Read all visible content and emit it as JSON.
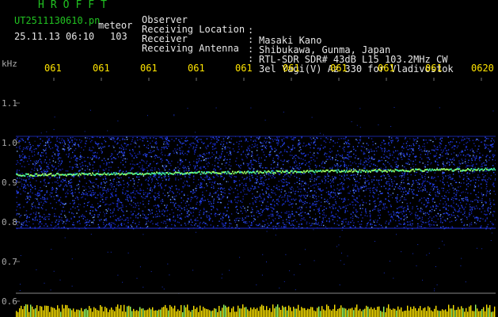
{
  "header": {
    "brand": "HROFFT",
    "filename": "UT2511130610.pn",
    "mode": "meteor",
    "datetime": "25.11.13 06:10",
    "count": "103",
    "info": [
      {
        "key": "Observer",
        "value": "Masaki Kano"
      },
      {
        "key": "Receiving Location",
        "value": "Shibukawa, Gunma, Japan"
      },
      {
        "key": "Receiver",
        "value": "RTL-SDR SDR# 43dB L15 103.2MHz CW"
      },
      {
        "key": "Receiving Antenna",
        "value": "3el Yagi(V) Az 330 for Vladivostok"
      }
    ],
    "separator": ":"
  },
  "axis": {
    "unit": "kHz",
    "y_ticks": [
      "1.1",
      "1.0",
      "0.9",
      "0.8",
      "0.7",
      "0.6"
    ],
    "time_ticks": [
      "061",
      "061",
      "061",
      "061",
      "061",
      "061",
      "061",
      "061",
      "061",
      "0620"
    ]
  },
  "colors": {
    "brand": "#21c221",
    "header_text": "#e6e6e6",
    "time_labels": "#ffe400",
    "axis_labels": "#a9a9a9",
    "spectrum": "#2050ff",
    "trace": "#40f0a0",
    "bars": "#ffe400"
  }
}
